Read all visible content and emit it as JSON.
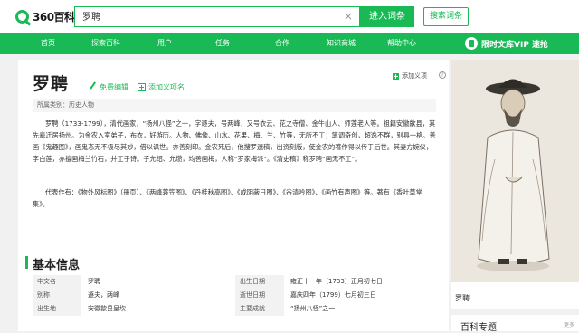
{
  "header": {
    "logo_text": "360百科",
    "search_value": "罗聘",
    "clear_glyph": "×",
    "enter_button": "进入词条",
    "search_button": "搜索词条"
  },
  "nav": {
    "items": [
      "首页",
      "探索百科",
      "用户",
      "任务",
      "合作",
      "知识商城",
      "帮助中心"
    ],
    "promo": "限时文库VIP 速抢"
  },
  "entry": {
    "title": "罗聘",
    "edit_label": "免费编辑",
    "add_meaning_label": "添加义项名",
    "add_tag_label": "添加义项",
    "help_glyph": "?",
    "category": "所属类别：历史人物",
    "para1": "罗聘（1733-1799），清代画家，“扬州八怪”之一，字遯夫，号两峰，又号衣云、花之寺僧、金牛山人、师莲老人等。祖籍安徽歙县，其先辈迁居扬州。为金农入室弟子，布衣，好游历。人物、佛像、山水、花果、梅、兰、竹等，无所不工；笔调奇创，超逸不群，别具一格。善画《鬼趣图》，画鬼态无不极尽其妙，借以讽世。亦善刻印。金农死后，他搜罗遗稿，出资刻版，使金农的著作得以传于后世。其妻方婉仪，字白莲，亦擅画梅兰竹石，并工于诗。子允绍、允缵，均善画梅，人称“罗家梅派”。《清史稿》称罗聘“画无不工”。",
    "para2": "代表作有：《物外风标图》（册页）、《两峰蓑笠图》、《丹桂秋高图》、《成阴蔽日图》、《谷清吟图》、《画竹有声图》等。著有《香叶草堂集》。"
  },
  "basic_info": {
    "title": "基本信息",
    "rows": [
      {
        "k1": "中文名",
        "v1": "罗聘",
        "k2": "出生日期",
        "v2": "雍正十一年（1733）正月初七日"
      },
      {
        "k1": "别称",
        "v1": "遯夫，两峰",
        "k2": "逝世日期",
        "v2": "嘉庆四年（1799）七月初三日"
      },
      {
        "k1": "出生地",
        "v1": "安徽歙县呈坎",
        "k2": "主要成就",
        "v2": "“扬州八怪”之一"
      }
    ]
  },
  "sidebar": {
    "image_caption": "罗聘",
    "special_title": "百科专题",
    "more_label": "更多"
  },
  "colors": {
    "brand_green": "#19b955"
  }
}
